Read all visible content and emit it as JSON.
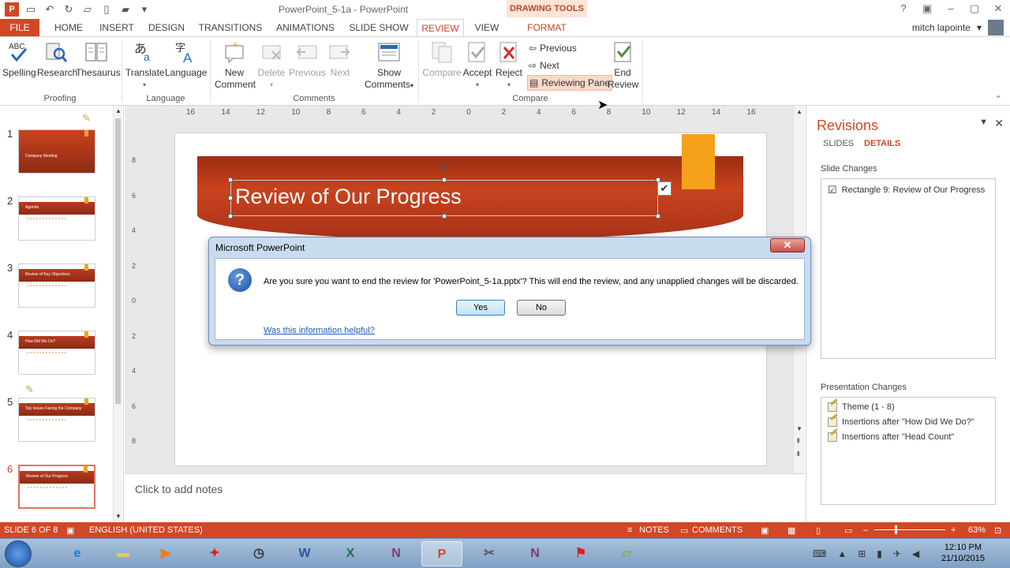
{
  "window": {
    "title": "PowerPoint_5-1a - PowerPoint",
    "contextual_tab": "DRAWING TOOLS",
    "user_name": "mitch lapointe"
  },
  "tabs": [
    "FILE",
    "HOME",
    "INSERT",
    "DESIGN",
    "TRANSITIONS",
    "ANIMATIONS",
    "SLIDE SHOW",
    "REVIEW",
    "VIEW",
    "FORMAT"
  ],
  "ribbon": {
    "proofing": {
      "spelling": "Spelling",
      "research": "Research",
      "thesaurus": "Thesaurus",
      "label": "Proofing"
    },
    "language": {
      "translate": "Translate",
      "language": "Language",
      "label": "Language"
    },
    "comments": {
      "new_comment_1": "New",
      "new_comment_2": "Comment",
      "delete": "Delete",
      "previous": "Previous",
      "next": "Next",
      "show_comments_1": "Show",
      "show_comments_2": "Comments",
      "label": "Comments"
    },
    "compare": {
      "compare": "Compare",
      "accept": "Accept",
      "reject": "Reject",
      "previous": "Previous",
      "next": "Next",
      "reviewing_pane": "Reviewing Pane",
      "end_review_1": "End",
      "end_review_2": "Review",
      "label": "Compare"
    }
  },
  "thumbnails": [
    {
      "num": "1",
      "title": "Company Meeting"
    },
    {
      "num": "2",
      "title": "Agenda"
    },
    {
      "num": "3",
      "title": "Review of Key Objectives"
    },
    {
      "num": "4",
      "title": "How Did We Do?"
    },
    {
      "num": "5",
      "title": "Top Issues Facing the Company"
    },
    {
      "num": "6",
      "title": "Review of Our Progress"
    }
  ],
  "ruler": {
    "h": [
      "16",
      "14",
      "12",
      "10",
      "8",
      "6",
      "4",
      "2",
      "0",
      "2",
      "4",
      "6",
      "8",
      "10",
      "12",
      "14",
      "16"
    ],
    "v": [
      "8",
      "6",
      "4",
      "2",
      "0",
      "2",
      "4",
      "6",
      "8"
    ]
  },
  "slide": {
    "title": "Review of Our Progress"
  },
  "notes": {
    "placeholder": "Click to add notes"
  },
  "revisions": {
    "title": "Revisions",
    "tab_slides": "SLIDES",
    "tab_details": "DETAILS",
    "slide_changes_label": "Slide Changes",
    "slide_changes": [
      "Rectangle 9: Review of Our Progress"
    ],
    "presentation_changes_label": "Presentation Changes",
    "presentation_changes": [
      "Theme (1 - 8)",
      "Insertions after \"How Did We Do?\"",
      "Insertions after \"Head Count\""
    ]
  },
  "dialog": {
    "title": "Microsoft PowerPoint",
    "message": "Are you sure you want to end the review for 'PowerPoint_5-1a.pptx'?  This will end the review, and any unapplied changes will be discarded.",
    "yes": "Yes",
    "no": "No",
    "link": "Was this information helpful?"
  },
  "statusbar": {
    "slide": "SLIDE 6 OF 8",
    "language": "ENGLISH (UNITED STATES)",
    "notes": "NOTES",
    "comments": "COMMENTS",
    "zoom": "63%"
  },
  "taskbar": {
    "time": "12:10 PM",
    "date": "21/10/2015"
  },
  "colors": {
    "accent": "#d24726",
    "slide_banner": "#b93b1d",
    "orange_tag": "#f5a11b"
  }
}
